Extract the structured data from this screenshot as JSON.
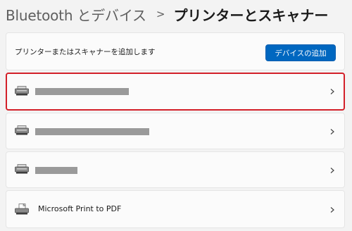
{
  "breadcrumb": {
    "parent": "Bluetooth とデバイス",
    "separator": ">",
    "current": "プリンターとスキャナー"
  },
  "add_section": {
    "label": "プリンターまたはスキャナーを追加します",
    "button_label": "デバイスの追加"
  },
  "printers": [
    {
      "name": "",
      "redacted": true,
      "highlighted": true,
      "icon": "printer-icon"
    },
    {
      "name": "",
      "redacted": true,
      "highlighted": false,
      "icon": "printer-icon"
    },
    {
      "name": "",
      "redacted": true,
      "highlighted": false,
      "icon": "printer-icon"
    },
    {
      "name": "Microsoft Print to PDF",
      "redacted": false,
      "highlighted": false,
      "icon": "pdf-printer-icon"
    }
  ],
  "colors": {
    "accent": "#0067c0",
    "highlight_border": "#d32029",
    "background": "#f3f3f3",
    "card": "#fbfbfb"
  }
}
